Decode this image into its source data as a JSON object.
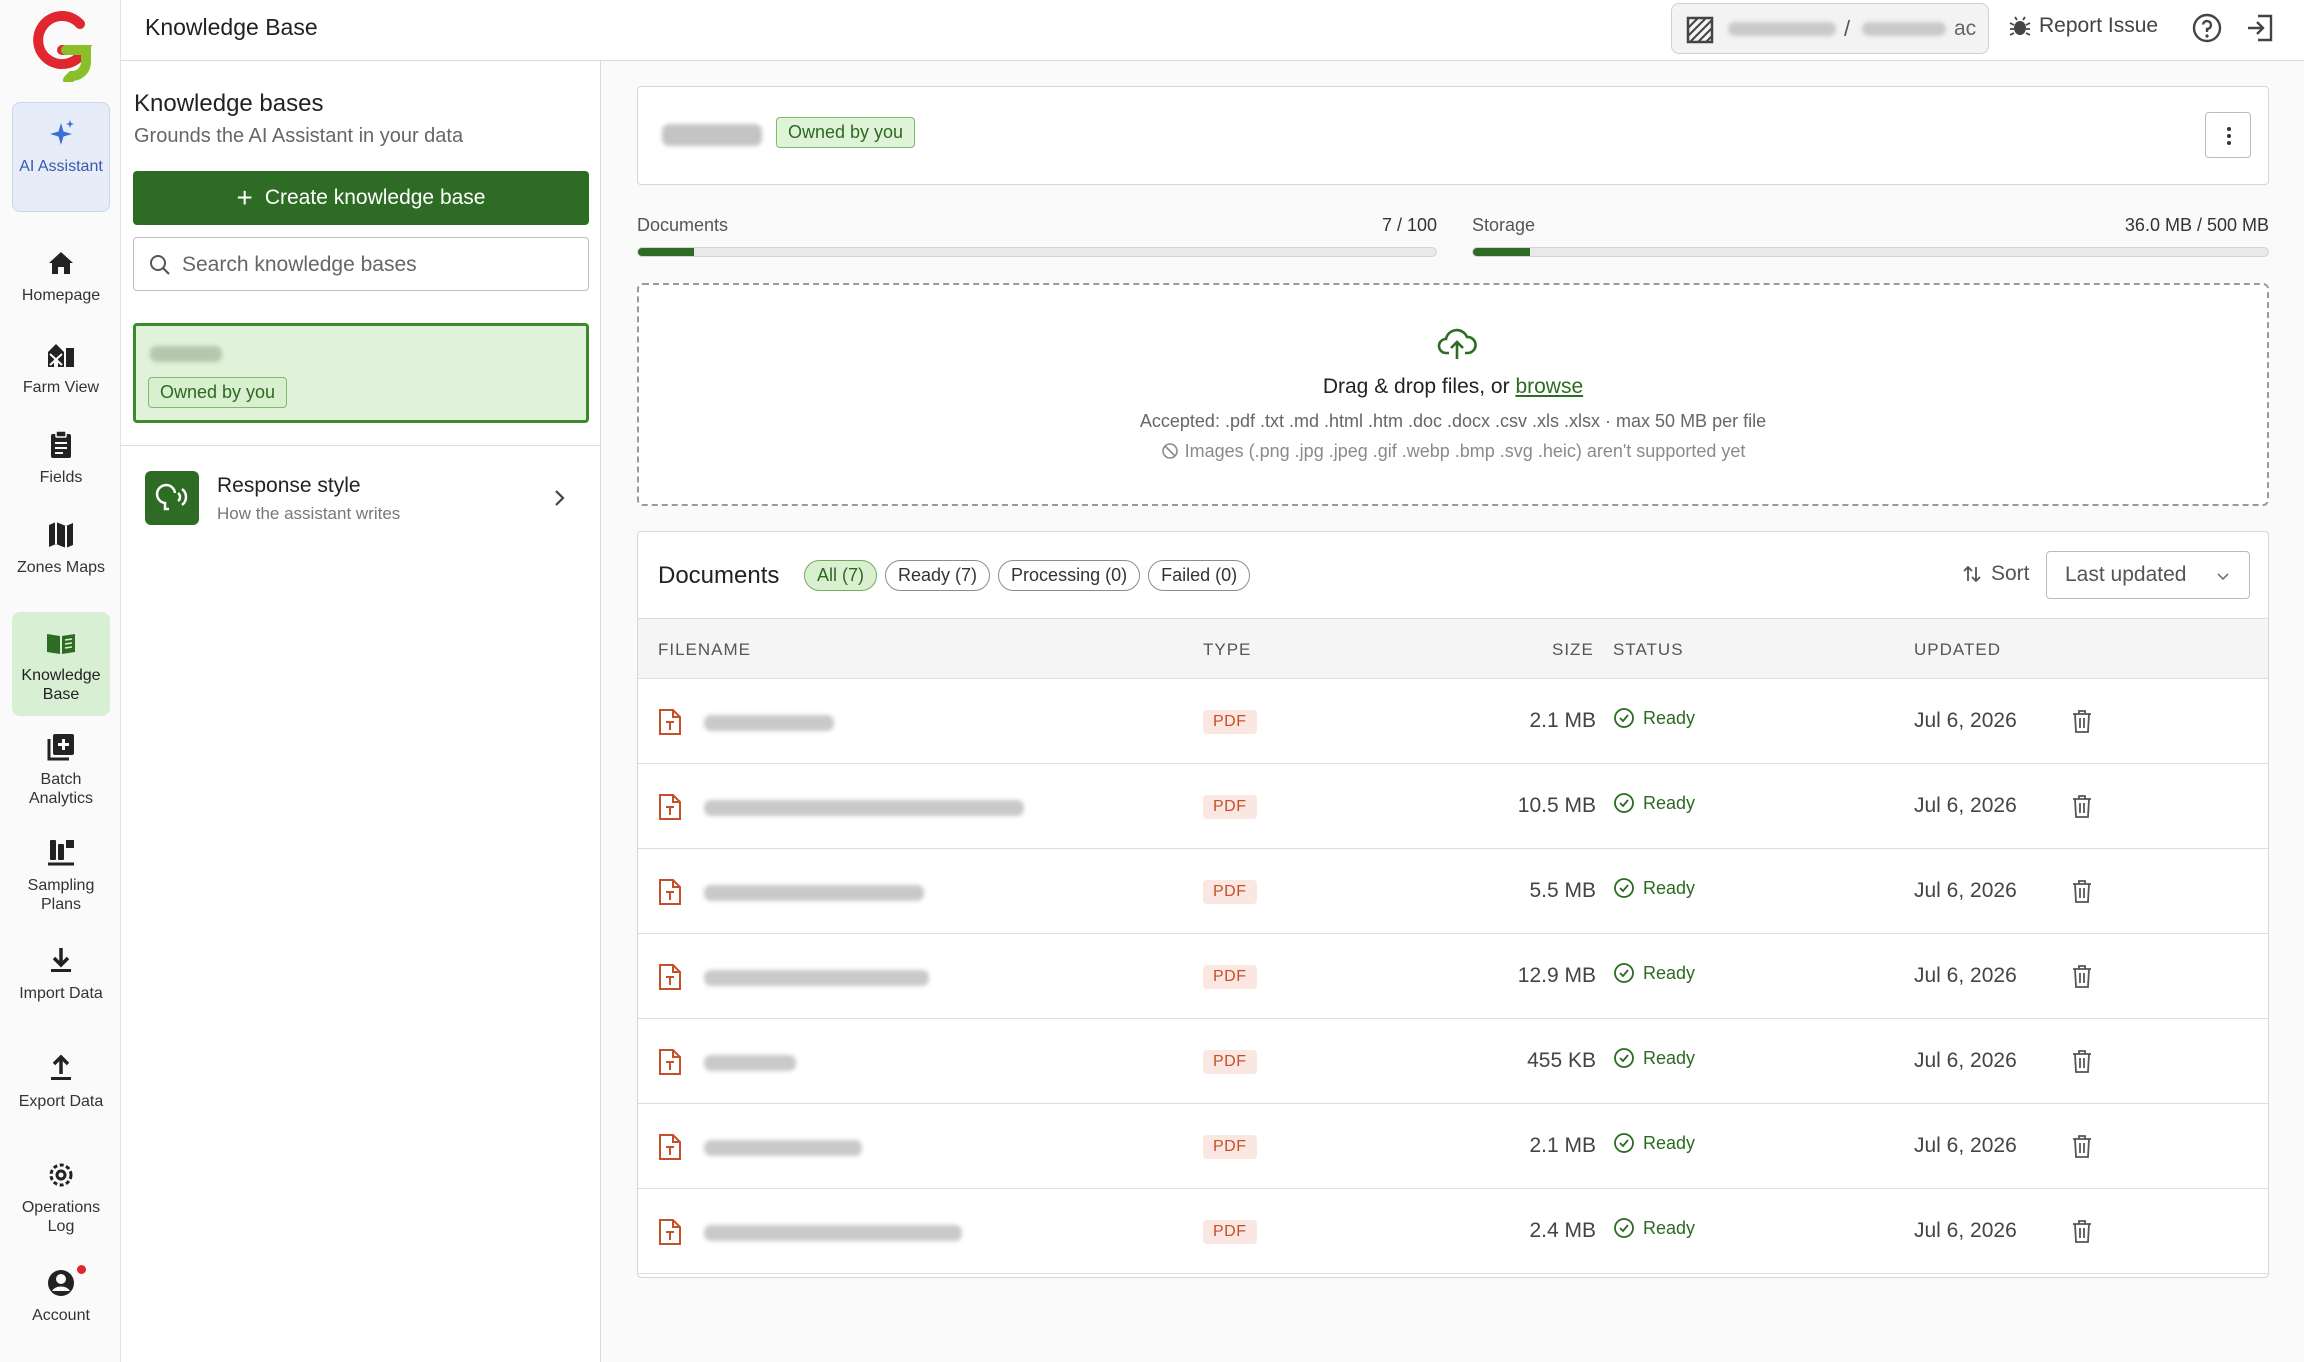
{
  "app": {
    "title": "Knowledge Base"
  },
  "nav": {
    "ai": {
      "label": "AI Assistant",
      "icon": "sparkle-icon"
    },
    "items": [
      {
        "label": "Homepage",
        "icon": "home-icon"
      },
      {
        "label": "Farm View",
        "icon": "farm-icon"
      },
      {
        "label": "Fields",
        "icon": "clipboard-icon"
      },
      {
        "label": "Zones Maps",
        "icon": "map-icon"
      },
      {
        "label": "Knowledge Base",
        "icon": "book-icon",
        "active": true
      },
      {
        "label": "Batch Analytics",
        "icon": "batch-icon"
      },
      {
        "label": "Sampling Plans",
        "icon": "sampling-icon"
      },
      {
        "label": "Import Data",
        "icon": "download-icon"
      },
      {
        "label": "Export Data",
        "icon": "upload-icon"
      },
      {
        "label": "Operations Log",
        "icon": "gear-icon"
      },
      {
        "label": "Account",
        "icon": "account-icon"
      }
    ]
  },
  "topbar": {
    "account_suffix": "ac",
    "report_label": "Report Issue"
  },
  "kb_panel": {
    "heading": "Knowledge bases",
    "subheading": "Grounds the AI Assistant in your data",
    "create_label": "Create knowledge base",
    "search_placeholder": "Search knowledge bases",
    "selected_badge": "Owned by you",
    "response_style": {
      "title": "Response style",
      "subtitle": "How the assistant writes"
    }
  },
  "main": {
    "kb_badge": "Owned by you",
    "usage": {
      "documents": {
        "label": "Documents",
        "value": "7 / 100",
        "fraction": 0.07
      },
      "storage": {
        "label": "Storage",
        "value": "36.0 MB / 500 MB",
        "fraction": 0.072
      }
    },
    "dropzone": {
      "main_text": "Drag & drop files, or ",
      "browse": "browse",
      "accepted": "Accepted: .pdf .txt .md .html .htm .doc .docx .csv .xls .xlsx · max 50 MB per file",
      "note": "Images (.png .jpg .jpeg .gif .webp .bmp .svg .heic) aren't supported yet"
    },
    "documents": {
      "title": "Documents",
      "filters": [
        "All (7)",
        "Ready (7)",
        "Processing (0)",
        "Failed (0)"
      ],
      "sort_label": "Sort",
      "sort_value": "Last updated",
      "columns": [
        "FILENAME",
        "TYPE",
        "SIZE",
        "STATUS",
        "UPDATED"
      ],
      "rows": [
        {
          "type": "PDF",
          "size": "2.1 MB",
          "status": "Ready",
          "updated": "Jul 6, 2026"
        },
        {
          "type": "PDF",
          "size": "10.5 MB",
          "status": "Ready",
          "updated": "Jul 6, 2026"
        },
        {
          "type": "PDF",
          "size": "5.5 MB",
          "status": "Ready",
          "updated": "Jul 6, 2026"
        },
        {
          "type": "PDF",
          "size": "12.9 MB",
          "status": "Ready",
          "updated": "Jul 6, 2026"
        },
        {
          "type": "PDF",
          "size": "455 KB",
          "status": "Ready",
          "updated": "Jul 6, 2026"
        },
        {
          "type": "PDF",
          "size": "2.1 MB",
          "status": "Ready",
          "updated": "Jul 6, 2026"
        },
        {
          "type": "PDF",
          "size": "2.4 MB",
          "status": "Ready",
          "updated": "Jul 6, 2026"
        }
      ]
    }
  },
  "colors": {
    "brand_green": "#2e6b24",
    "ai_blue": "#3a5ba8",
    "pdf_red": "#c4502a"
  }
}
